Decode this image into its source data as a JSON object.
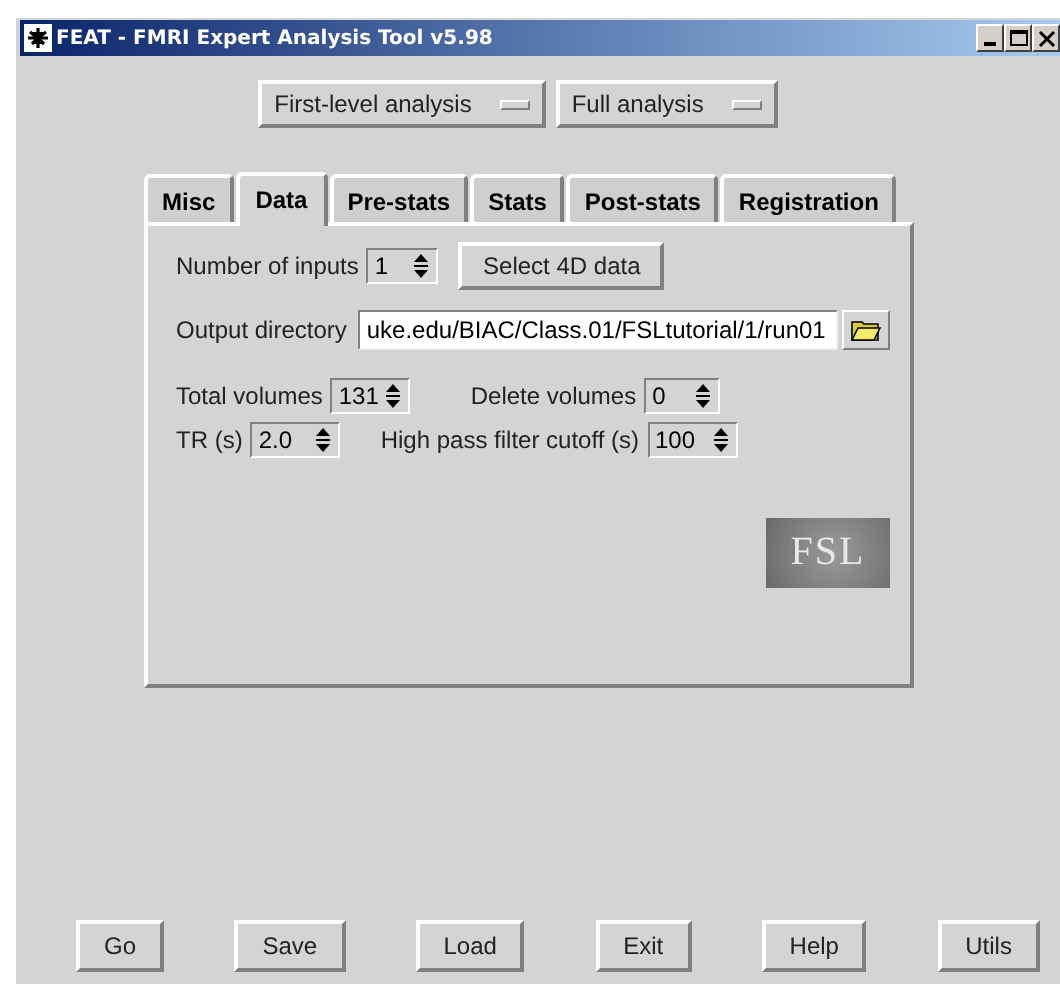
{
  "window": {
    "title": "FEAT - FMRI Expert Analysis Tool v5.98"
  },
  "menus": [
    {
      "value": "First-level analysis"
    },
    {
      "value": "Full analysis"
    }
  ],
  "tabs": [
    {
      "label": "Misc",
      "selected": false
    },
    {
      "label": "Data",
      "selected": true
    },
    {
      "label": "Pre-stats",
      "selected": false
    },
    {
      "label": "Stats",
      "selected": false
    },
    {
      "label": "Post-stats",
      "selected": false
    },
    {
      "label": "Registration",
      "selected": false
    }
  ],
  "data_panel": {
    "number_of_inputs": {
      "label": "Number of inputs",
      "value": "1"
    },
    "select_button": "Select 4D data",
    "output_directory": {
      "label": "Output directory",
      "value": "uke.edu/BIAC/Class.01/FSLtutorial/1/run01"
    },
    "total_volumes": {
      "label": "Total volumes",
      "value": "131"
    },
    "delete_volumes": {
      "label": "Delete volumes",
      "value": "0"
    },
    "tr": {
      "label": "TR (s)",
      "value": "2.0"
    },
    "high_pass": {
      "label": "High pass filter cutoff (s)",
      "value": "100"
    },
    "logo": "FSL"
  },
  "buttons": [
    "Go",
    "Save",
    "Load",
    "Exit",
    "Help",
    "Utils"
  ]
}
